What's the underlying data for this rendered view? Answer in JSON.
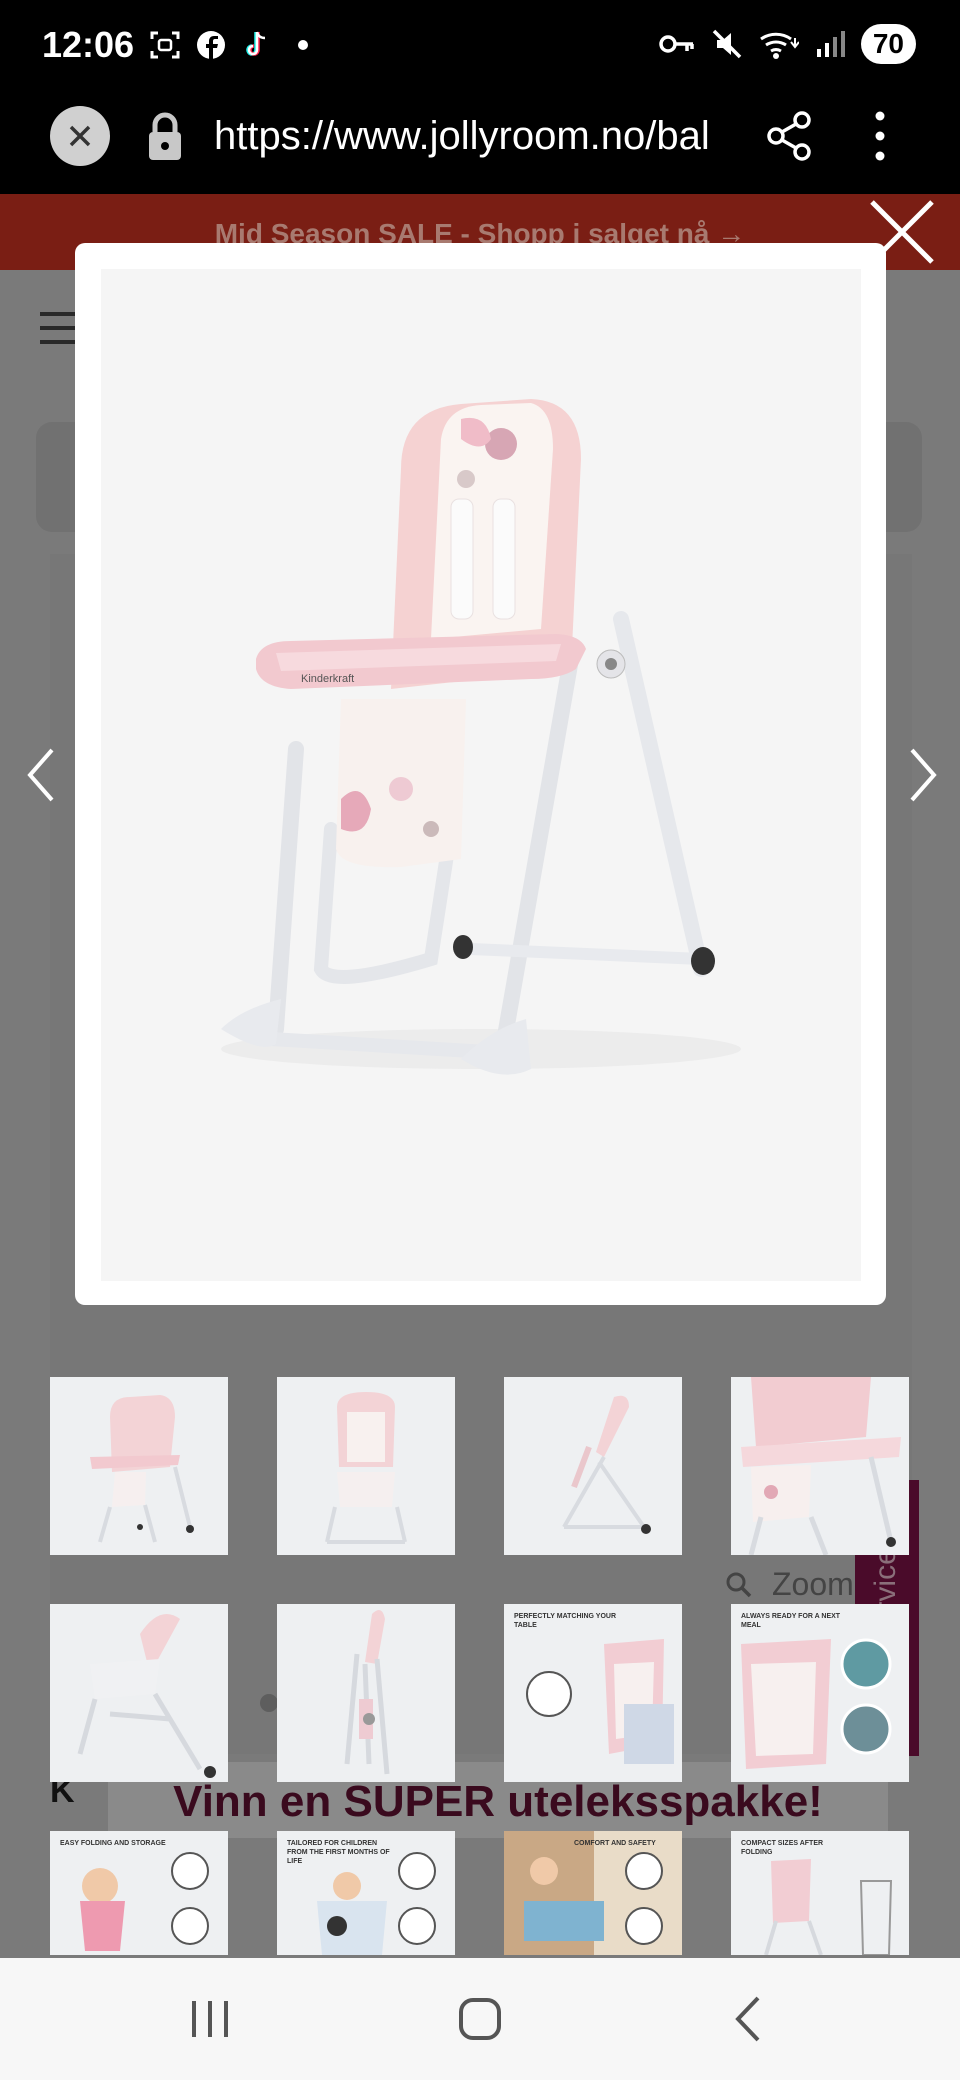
{
  "status_bar": {
    "time": "12:06",
    "battery": "70",
    "left_icons": [
      "screenshot-icon",
      "facebook-icon",
      "tiktok-icon",
      "dot-icon"
    ],
    "right_icons": [
      "key-icon",
      "mute-icon",
      "wifi-icon",
      "signal-icon"
    ]
  },
  "browser": {
    "url": "https://www.jollyroom.no/bal"
  },
  "page": {
    "promo_text": "Mid Season SALE - Shopp i salget nå →",
    "zoom_label": "Zoom",
    "kundeservice_label": "Kundeservice",
    "banner_prefix": "K",
    "banner_text": "Vinn en SUPER uteleksspakke!"
  },
  "product": {
    "brand_on_tray": "Kinderkraft"
  },
  "thumbnails": [
    {
      "caption": ""
    },
    {
      "caption": ""
    },
    {
      "caption": ""
    },
    {
      "caption": ""
    },
    {
      "caption": ""
    },
    {
      "caption": ""
    },
    {
      "caption": "Perfectly matching your table"
    },
    {
      "caption": "Always ready for a next meal"
    },
    {
      "caption": "Easy folding and storage"
    },
    {
      "caption": "Tailored for children from the first months of life"
    },
    {
      "caption": "Comfort and safety"
    },
    {
      "caption": "Compact sizes after folding"
    }
  ],
  "colors": {
    "promo_bg": "#7a1e14",
    "chair_pink": "#f2cfcf",
    "kundeservice_bg": "#4a0b2a"
  }
}
